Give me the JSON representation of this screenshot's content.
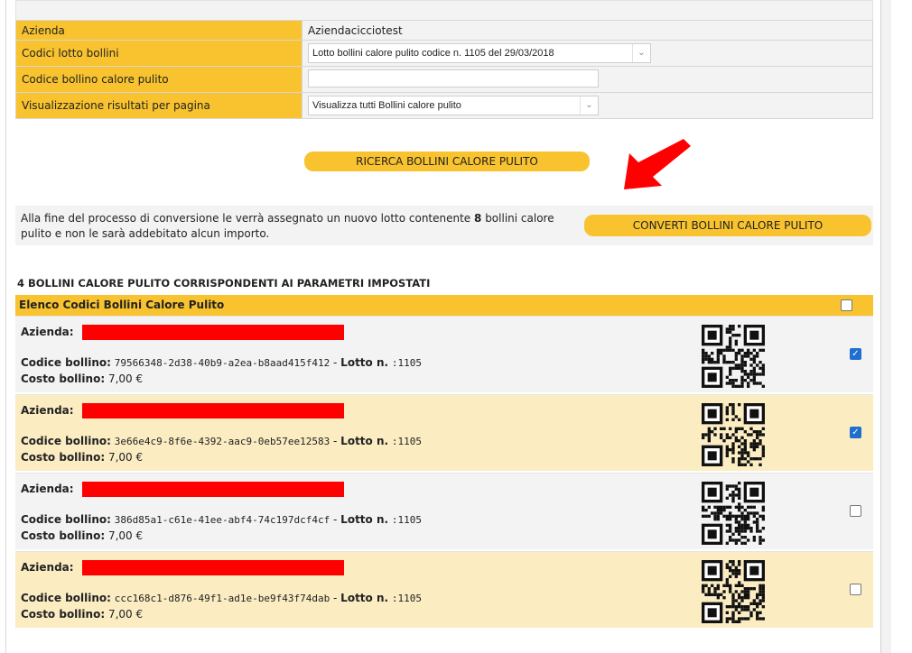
{
  "filters": [
    {
      "label": "Azienda",
      "value": "Aziendacicciotest",
      "type": "text"
    },
    {
      "label": "Codici lotto bollini",
      "value": "Lotto bollini calore pulito codice n. 1105 del 29/03/2018",
      "type": "select"
    },
    {
      "label": "Codice bollino calore pulito",
      "value": "",
      "type": "input"
    },
    {
      "label": "Visualizzazione risultati per pagina",
      "value": "Visualizza tutti Bollini calore pulito",
      "type": "select"
    }
  ],
  "search_button": "RICERCA BOLLINI CALORE PULITO",
  "convert": {
    "text_before": "Alla fine del processo di conversione le verrà assegnato un nuovo lotto contenente ",
    "count": "8",
    "text_after": " bollini calore pulito e non le sarà addebitato alcun importo.",
    "button": "CONVERTI BOLLINI CALORE PULITO"
  },
  "results_title": "4 BOLLINI CALORE PULITO CORRISPONDENTI AI PARAMETRI IMPOSTATI",
  "list": {
    "header": "Elenco Codici Bollini Calore Pulito",
    "select_all_checked": false,
    "labels": {
      "azienda": "Azienda:",
      "codice": "Codice bollino:",
      "lotto": "Lotto n.",
      "costo": "Costo bollino:"
    },
    "rows": [
      {
        "codice": "79566348-2d38-40b9-a2ea-b8aad415f412",
        "lotto": ":1105",
        "costo": "7,00 €",
        "checked": true
      },
      {
        "codice": "3e66e4c9-8f6e-4392-aac9-0eb57ee12583",
        "lotto": ":1105",
        "costo": "7,00 €",
        "checked": true
      },
      {
        "codice": "386d85a1-c61e-41ee-abf4-74c197dcf4cf",
        "lotto": ":1105",
        "costo": "7,00 €",
        "checked": false
      },
      {
        "codice": "ccc168c1-d876-49f1-ad1e-be9f43f74dab",
        "lotto": ":1105",
        "costo": "7,00 €",
        "checked": false
      }
    ]
  },
  "colors": {
    "accent": "#f8c32f",
    "arrow": "#ff0000",
    "redaction": "#ff0000",
    "checkbox_on": "#1f6fd1"
  },
  "icons": {
    "dropdown": "chevron-down-icon",
    "annotation": "red-arrow-icon",
    "qr": "qr-code-icon"
  }
}
